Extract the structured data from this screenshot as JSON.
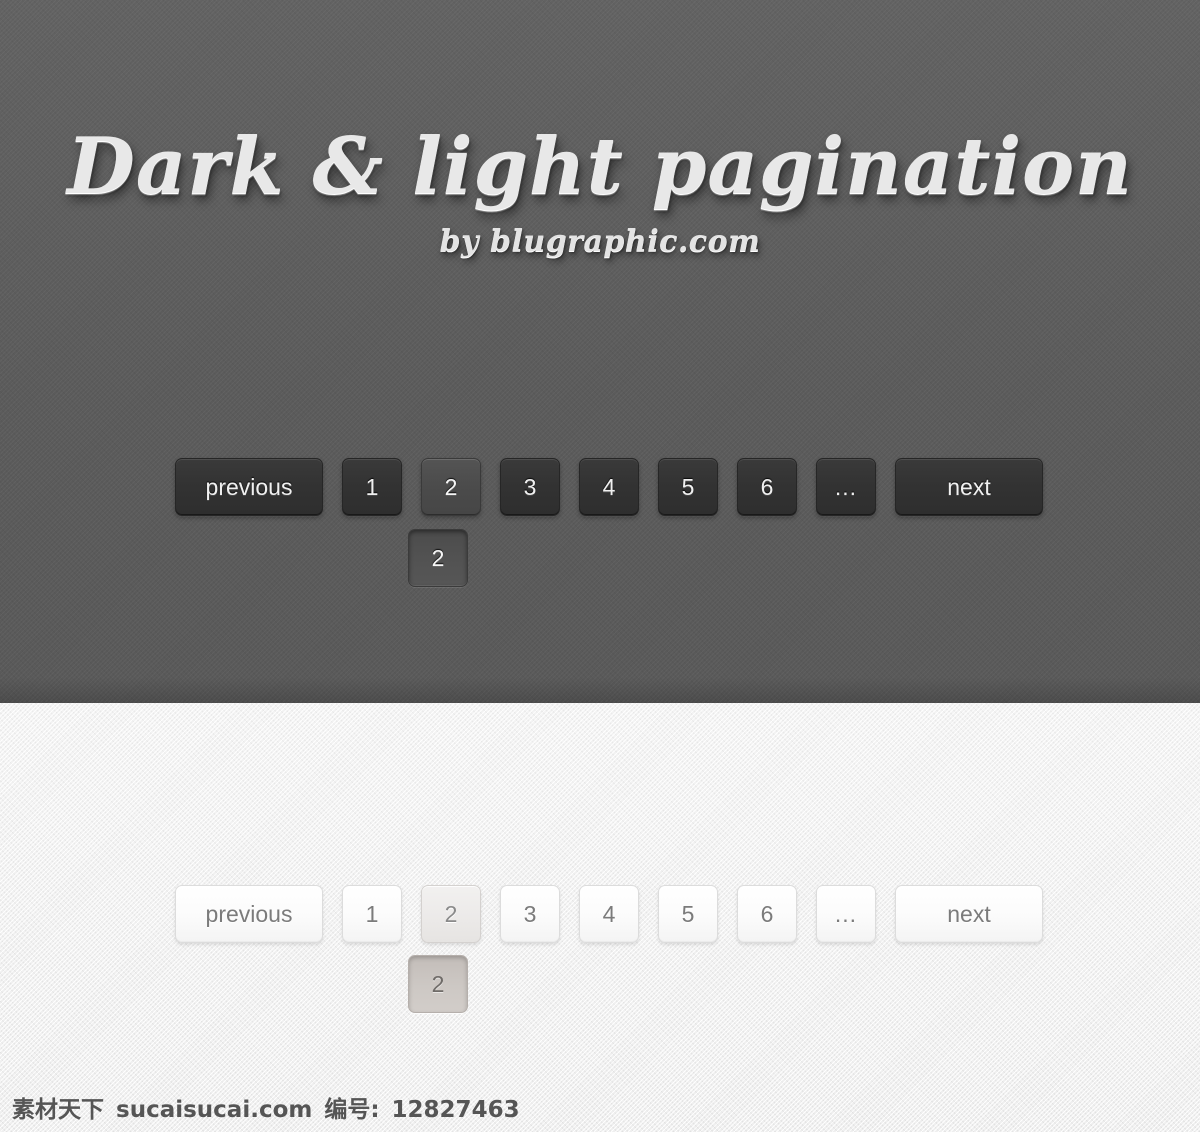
{
  "header": {
    "title": "Dark & light pagination",
    "subtitle": "by blugraphic.com"
  },
  "colors": {
    "dark_background": "#5e5e5e",
    "light_background": "#efefef",
    "dark_button": "#333333",
    "dark_button_active": "#4c4c4c",
    "light_button": "#fbfbfb",
    "light_button_active": "#eceae9",
    "light_button_pressed": "#cdc8c4",
    "dark_text": "#f0f0f0",
    "light_text": "#7b7b7b"
  },
  "dark_pagination": {
    "previous_label": "previous",
    "next_label": "next",
    "ellipsis_label": "...",
    "pages": [
      "1",
      "2",
      "3",
      "4",
      "5",
      "6"
    ],
    "active_page": "2",
    "pressed_page": "2"
  },
  "light_pagination": {
    "previous_label": "previous",
    "next_label": "next",
    "ellipsis_label": "...",
    "pages": [
      "1",
      "2",
      "3",
      "4",
      "5",
      "6"
    ],
    "active_page": "2",
    "pressed_page": "2"
  },
  "watermark": {
    "site_cn": "素材天下",
    "site_url": "sucaisucai.com",
    "id_label": "编号:",
    "id_number": "12827463"
  }
}
